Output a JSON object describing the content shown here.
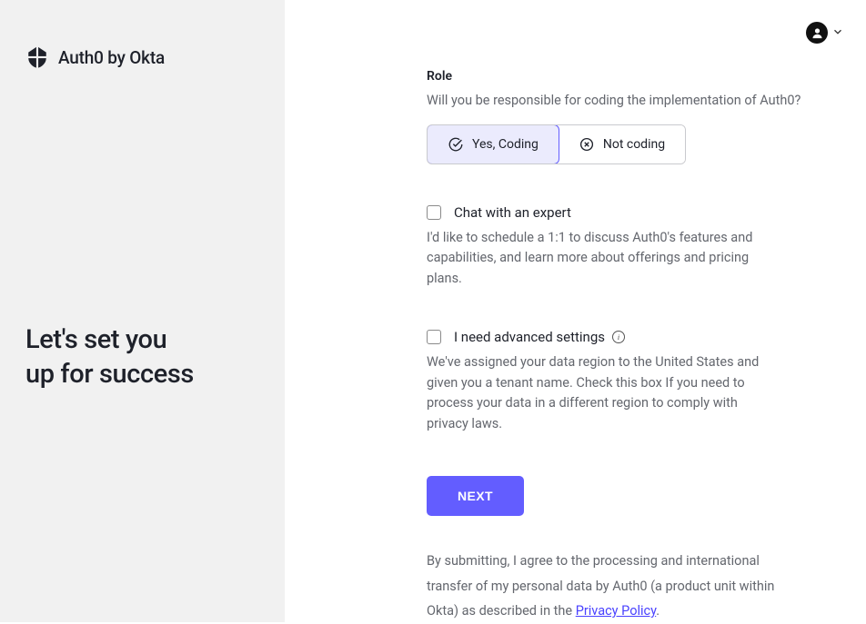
{
  "brand": {
    "name": "Auth0 by Okta"
  },
  "sidebar": {
    "headline_line1": "Let's set you",
    "headline_line2": "up for success"
  },
  "role": {
    "label": "Role",
    "question": "Will you be responsible for coding the implementation of Auth0?",
    "option_yes": "Yes, Coding",
    "option_no": "Not coding",
    "selected": "yes"
  },
  "expert": {
    "label": "Chat with an expert",
    "description": "I'd like to schedule a 1:1 to discuss Auth0's features and capabilities, and learn more about offerings and pricing plans.",
    "checked": false
  },
  "advanced": {
    "label": "I need advanced settings",
    "description": "We've assigned your data region to the United States and given you a tenant name. Check this box If you need to process your data in a different region to comply with privacy laws.",
    "checked": false
  },
  "buttons": {
    "next": "NEXT"
  },
  "agreement": {
    "text_pre": "By submitting, I agree to the processing and international transfer of my personal data by Auth0 (a product unit within Okta) as described in the ",
    "link_label": "Privacy Policy",
    "text_post": "."
  },
  "colors": {
    "accent": "#635dff"
  }
}
